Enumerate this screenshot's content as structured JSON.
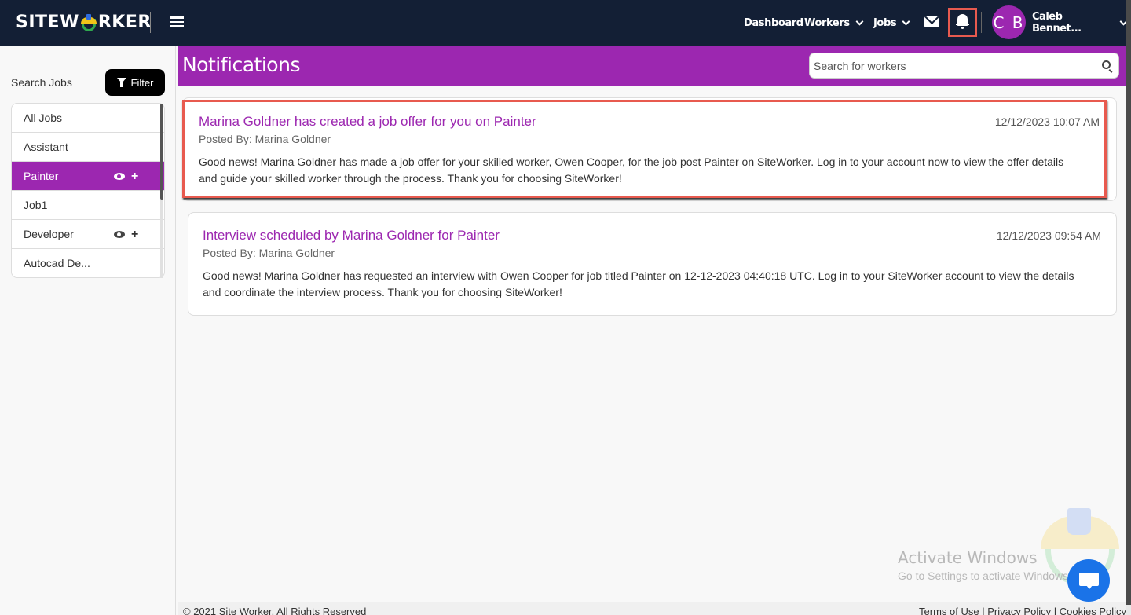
{
  "brand": {
    "name_prefix": "SITEW",
    "name_suffix": "RKER"
  },
  "nav": {
    "dashboard": "Dashboard",
    "workers": "Workers",
    "jobs": "Jobs",
    "user_initials": "C B",
    "user_name": "Caleb Bennet..."
  },
  "sidebar": {
    "search_label": "Search Jobs",
    "filter_label": "Filter",
    "jobs": [
      {
        "label": "All Jobs",
        "active": false,
        "actions": false
      },
      {
        "label": "Assistant",
        "active": false,
        "actions": false
      },
      {
        "label": "Painter",
        "active": true,
        "actions": true
      },
      {
        "label": "Job1",
        "active": false,
        "actions": false
      },
      {
        "label": "Developer",
        "active": false,
        "actions": true
      },
      {
        "label": "Autocad De...",
        "active": false,
        "actions": false
      }
    ]
  },
  "header": {
    "title": "Notifications",
    "search_placeholder": "Search for workers"
  },
  "notifications": [
    {
      "title": "Marina Goldner has created a job offer for you on Painter",
      "posted_by": "Posted By: Marina Goldner",
      "timestamp": "12/12/2023 10:07 AM",
      "body_line1": "Good news! Marina Goldner has made a job offer for your skilled worker, Owen Cooper, for the job post Painter on SiteWorker. Log in to your account now to view the offer details",
      "body_line2": "and guide your skilled worker through the process. Thank you for choosing SiteWorker!"
    },
    {
      "title": "Interview scheduled by Marina Goldner for Painter",
      "posted_by": "Posted By: Marina Goldner",
      "timestamp": "12/12/2023 09:54 AM",
      "body_line1": "Good news! Marina Goldner has requested an interview with Owen Cooper for job titled Painter on 12-12-2023 04:40:18 UTC. Log in to your SiteWorker account to view the details",
      "body_line2": "and coordinate the interview process. Thank you for choosing SiteWorker!"
    }
  ],
  "watermark": {
    "title": "Activate Windows",
    "subtitle": "Go to Settings to activate Windows."
  },
  "footer": {
    "copyright": "© 2021 Site Worker. All Rights Reserved",
    "terms": "Terms of Use",
    "privacy": "Privacy Policy",
    "cookies": "Cookies Policy",
    "separator": " | "
  },
  "colors": {
    "navbar": "#131f35",
    "accent": "#9c27b0",
    "highlight": "#e85a4f",
    "chat": "#1a73e8"
  }
}
